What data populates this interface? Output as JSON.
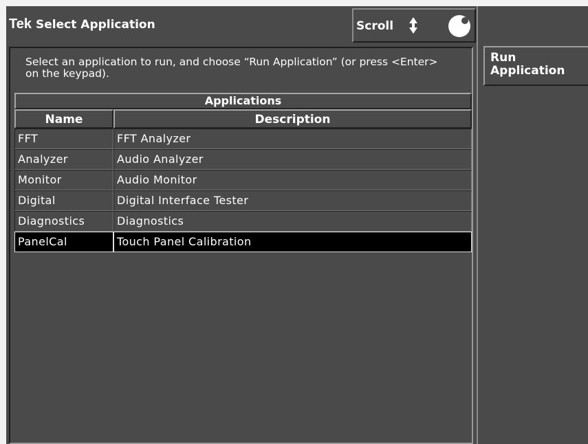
{
  "titlebar": {
    "brand": "Tek",
    "title": "Select Application"
  },
  "scroll_control": {
    "label": "Scroll",
    "arrows_icon": "up-down-arrows-icon",
    "knob_icon": "knob-icon"
  },
  "instructions": "Select an application to run, and choose “Run Application” (or press <Enter> on the keypad).",
  "table": {
    "group_header": "Applications",
    "columns": [
      "Name",
      "Description"
    ],
    "rows": [
      {
        "name": "FFT",
        "description": "FFT Analyzer"
      },
      {
        "name": "Analyzer",
        "description": "Audio Analyzer"
      },
      {
        "name": "Monitor",
        "description": "Audio Monitor"
      },
      {
        "name": "Digital",
        "description": "Digital Interface Tester"
      },
      {
        "name": "Diagnostics",
        "description": "Diagnostics"
      },
      {
        "name": "PanelCal",
        "description": "Touch Panel Calibration"
      }
    ],
    "selected_row": 5
  },
  "side_buttons": {
    "run_application": "Run Application"
  },
  "colors": {
    "background": "#4a4a4a",
    "text": "#ffffff",
    "selected_row": "#000000"
  }
}
